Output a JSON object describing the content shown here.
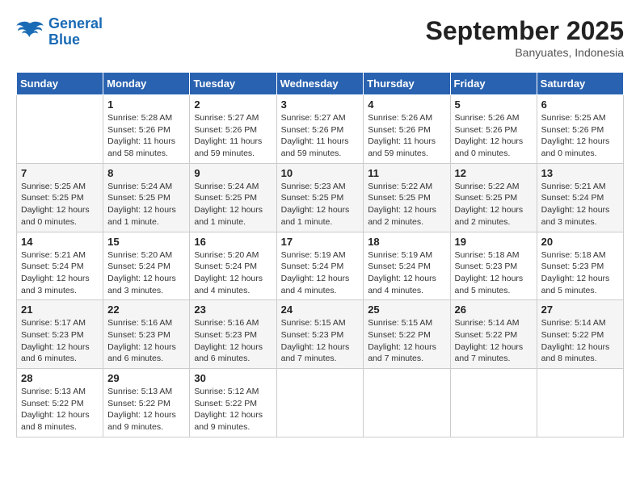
{
  "header": {
    "logo_line1": "General",
    "logo_line2": "Blue",
    "month_title": "September 2025",
    "location": "Banyuates, Indonesia"
  },
  "days_of_week": [
    "Sunday",
    "Monday",
    "Tuesday",
    "Wednesday",
    "Thursday",
    "Friday",
    "Saturday"
  ],
  "weeks": [
    [
      {
        "day": "",
        "info": ""
      },
      {
        "day": "1",
        "info": "Sunrise: 5:28 AM\nSunset: 5:26 PM\nDaylight: 11 hours\nand 58 minutes."
      },
      {
        "day": "2",
        "info": "Sunrise: 5:27 AM\nSunset: 5:26 PM\nDaylight: 11 hours\nand 59 minutes."
      },
      {
        "day": "3",
        "info": "Sunrise: 5:27 AM\nSunset: 5:26 PM\nDaylight: 11 hours\nand 59 minutes."
      },
      {
        "day": "4",
        "info": "Sunrise: 5:26 AM\nSunset: 5:26 PM\nDaylight: 11 hours\nand 59 minutes."
      },
      {
        "day": "5",
        "info": "Sunrise: 5:26 AM\nSunset: 5:26 PM\nDaylight: 12 hours\nand 0 minutes."
      },
      {
        "day": "6",
        "info": "Sunrise: 5:25 AM\nSunset: 5:26 PM\nDaylight: 12 hours\nand 0 minutes."
      }
    ],
    [
      {
        "day": "7",
        "info": "Sunrise: 5:25 AM\nSunset: 5:25 PM\nDaylight: 12 hours\nand 0 minutes."
      },
      {
        "day": "8",
        "info": "Sunrise: 5:24 AM\nSunset: 5:25 PM\nDaylight: 12 hours\nand 1 minute."
      },
      {
        "day": "9",
        "info": "Sunrise: 5:24 AM\nSunset: 5:25 PM\nDaylight: 12 hours\nand 1 minute."
      },
      {
        "day": "10",
        "info": "Sunrise: 5:23 AM\nSunset: 5:25 PM\nDaylight: 12 hours\nand 1 minute."
      },
      {
        "day": "11",
        "info": "Sunrise: 5:22 AM\nSunset: 5:25 PM\nDaylight: 12 hours\nand 2 minutes."
      },
      {
        "day": "12",
        "info": "Sunrise: 5:22 AM\nSunset: 5:25 PM\nDaylight: 12 hours\nand 2 minutes."
      },
      {
        "day": "13",
        "info": "Sunrise: 5:21 AM\nSunset: 5:24 PM\nDaylight: 12 hours\nand 3 minutes."
      }
    ],
    [
      {
        "day": "14",
        "info": "Sunrise: 5:21 AM\nSunset: 5:24 PM\nDaylight: 12 hours\nand 3 minutes."
      },
      {
        "day": "15",
        "info": "Sunrise: 5:20 AM\nSunset: 5:24 PM\nDaylight: 12 hours\nand 3 minutes."
      },
      {
        "day": "16",
        "info": "Sunrise: 5:20 AM\nSunset: 5:24 PM\nDaylight: 12 hours\nand 4 minutes."
      },
      {
        "day": "17",
        "info": "Sunrise: 5:19 AM\nSunset: 5:24 PM\nDaylight: 12 hours\nand 4 minutes."
      },
      {
        "day": "18",
        "info": "Sunrise: 5:19 AM\nSunset: 5:24 PM\nDaylight: 12 hours\nand 4 minutes."
      },
      {
        "day": "19",
        "info": "Sunrise: 5:18 AM\nSunset: 5:23 PM\nDaylight: 12 hours\nand 5 minutes."
      },
      {
        "day": "20",
        "info": "Sunrise: 5:18 AM\nSunset: 5:23 PM\nDaylight: 12 hours\nand 5 minutes."
      }
    ],
    [
      {
        "day": "21",
        "info": "Sunrise: 5:17 AM\nSunset: 5:23 PM\nDaylight: 12 hours\nand 6 minutes."
      },
      {
        "day": "22",
        "info": "Sunrise: 5:16 AM\nSunset: 5:23 PM\nDaylight: 12 hours\nand 6 minutes."
      },
      {
        "day": "23",
        "info": "Sunrise: 5:16 AM\nSunset: 5:23 PM\nDaylight: 12 hours\nand 6 minutes."
      },
      {
        "day": "24",
        "info": "Sunrise: 5:15 AM\nSunset: 5:23 PM\nDaylight: 12 hours\nand 7 minutes."
      },
      {
        "day": "25",
        "info": "Sunrise: 5:15 AM\nSunset: 5:22 PM\nDaylight: 12 hours\nand 7 minutes."
      },
      {
        "day": "26",
        "info": "Sunrise: 5:14 AM\nSunset: 5:22 PM\nDaylight: 12 hours\nand 7 minutes."
      },
      {
        "day": "27",
        "info": "Sunrise: 5:14 AM\nSunset: 5:22 PM\nDaylight: 12 hours\nand 8 minutes."
      }
    ],
    [
      {
        "day": "28",
        "info": "Sunrise: 5:13 AM\nSunset: 5:22 PM\nDaylight: 12 hours\nand 8 minutes."
      },
      {
        "day": "29",
        "info": "Sunrise: 5:13 AM\nSunset: 5:22 PM\nDaylight: 12 hours\nand 9 minutes."
      },
      {
        "day": "30",
        "info": "Sunrise: 5:12 AM\nSunset: 5:22 PM\nDaylight: 12 hours\nand 9 minutes."
      },
      {
        "day": "",
        "info": ""
      },
      {
        "day": "",
        "info": ""
      },
      {
        "day": "",
        "info": ""
      },
      {
        "day": "",
        "info": ""
      }
    ]
  ]
}
